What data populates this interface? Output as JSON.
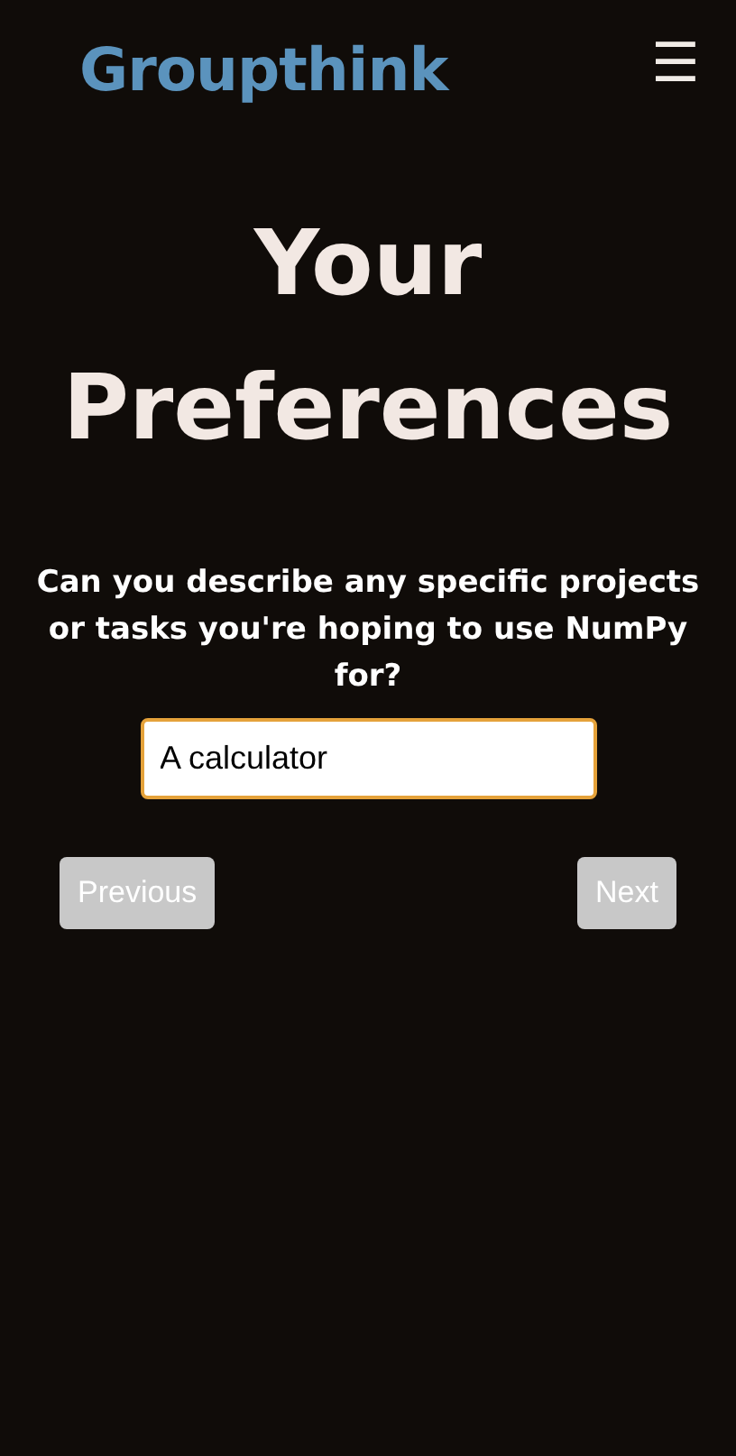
{
  "header": {
    "logo": "Groupthink",
    "menu_icon": "☰"
  },
  "heading": "Your Preferences",
  "question": {
    "text": "Can you describe any specific projects or tasks you're hoping to use NumPy for?",
    "value": "A calculator"
  },
  "buttons": [
    {
      "label": "Previous",
      "disabled": true
    },
    {
      "label": "Next",
      "disabled": true
    }
  ]
}
